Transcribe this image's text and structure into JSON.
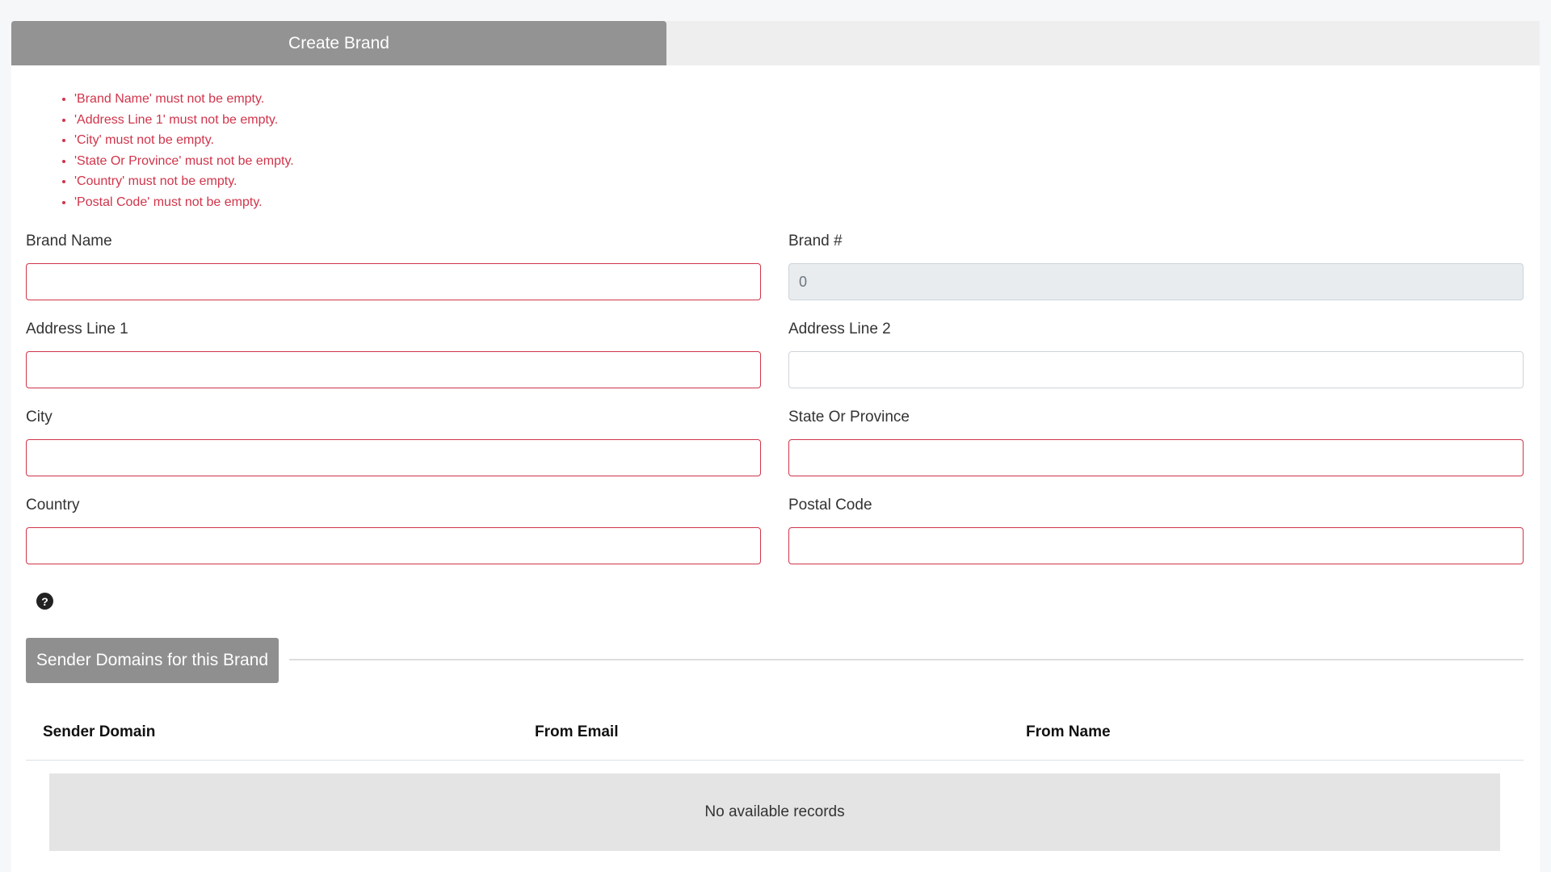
{
  "tabs": {
    "active_label": "Create Brand"
  },
  "validation_errors": [
    "'Brand Name' must not be empty.",
    "'Address Line 1' must not be empty.",
    "'City' must not be empty.",
    "'State Or Province' must not be empty.",
    "'Country' must not be empty.",
    "'Postal Code' must not be empty."
  ],
  "form": {
    "brand_name": {
      "label": "Brand Name",
      "value": ""
    },
    "brand_number": {
      "label": "Brand #",
      "value": "0"
    },
    "address_line_1": {
      "label": "Address Line 1",
      "value": ""
    },
    "address_line_2": {
      "label": "Address Line 2",
      "value": ""
    },
    "city": {
      "label": "City",
      "value": ""
    },
    "state_or_province": {
      "label": "State Or Province",
      "value": ""
    },
    "country": {
      "label": "Country",
      "value": ""
    },
    "postal_code": {
      "label": "Postal Code",
      "value": ""
    }
  },
  "help_icon": "question-circle-icon",
  "sender_domains": {
    "section_title": "Sender Domains for this Brand",
    "columns": [
      "Sender Domain",
      "From Email",
      "From Name"
    ],
    "rows": [],
    "empty_message": "No available records"
  },
  "colors": {
    "error": "#d0344a",
    "tab_active_bg": "#939393",
    "section_header_bg": "#8f8f8f",
    "empty_row_bg": "#e4e4e4"
  }
}
